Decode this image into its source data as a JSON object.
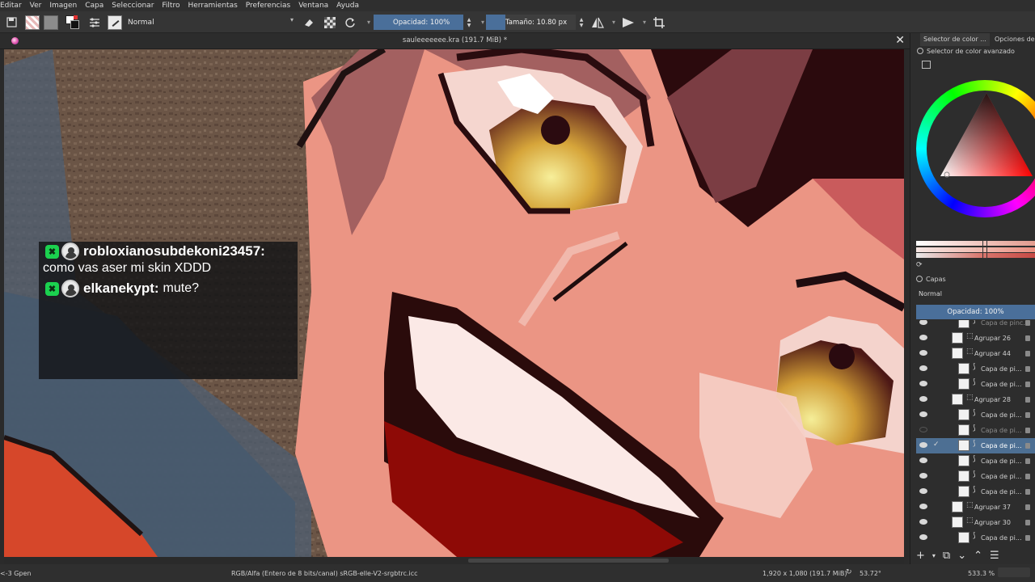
{
  "menu": [
    "Editar",
    "Ver",
    "Imagen",
    "Capa",
    "Seleccionar",
    "Filtro",
    "Herramientas",
    "Preferencias",
    "Ventana",
    "Ayuda"
  ],
  "toolbar": {
    "blend_mode": "Normal",
    "opacity_label": "Opacidad: 100%",
    "opacity_fraction": 1.0,
    "size_label": "Tamaño: 10.80 px"
  },
  "document": {
    "title": "saulееееееe.kra (191.7 MiB) *"
  },
  "chat": {
    "messages": [
      {
        "user": "robloxianosubdekoni23457:",
        "text": "como vas aser mi skin XDDD"
      },
      {
        "user": "elkanekypt:",
        "text": "mute?"
      }
    ]
  },
  "docker": {
    "tabs": [
      "Selector de color ...",
      "Opciones de h"
    ],
    "color_selector_title": "Selector de color avanzado",
    "layers_title": "Capas",
    "layer_blend": "Normal",
    "layer_opacity": "Opacidad:  100%",
    "layers": [
      {
        "name": "Capa de pinc...",
        "group": false,
        "visible": true,
        "dim": true
      },
      {
        "name": "Agrupar 26",
        "group": true,
        "visible": true
      },
      {
        "name": "Agrupar 44",
        "group": true,
        "visible": true
      },
      {
        "name": "Capa de pi...",
        "group": false,
        "visible": true
      },
      {
        "name": "Capa de pi...",
        "group": false,
        "visible": true
      },
      {
        "name": "Agrupar 28",
        "group": true,
        "visible": true
      },
      {
        "name": "Capa de pi...",
        "group": false,
        "visible": true
      },
      {
        "name": "Capa de pi...",
        "group": false,
        "visible": false,
        "dim": true
      },
      {
        "name": "Capa de pi...",
        "group": false,
        "visible": true,
        "selected": true
      },
      {
        "name": "Capa de pi...",
        "group": false,
        "visible": true
      },
      {
        "name": "Capa de pi...",
        "group": false,
        "visible": true
      },
      {
        "name": "Capa de pi...",
        "group": false,
        "visible": true
      },
      {
        "name": "Agrupar 37",
        "group": true,
        "visible": true
      },
      {
        "name": "Agrupar 30",
        "group": true,
        "visible": true
      },
      {
        "name": "Capa de pi...",
        "group": false,
        "visible": true
      }
    ]
  },
  "status": {
    "brush": "<-3 Gpen",
    "color_space": "RGB/Alfa (Entero de 8 bits/canal)  sRGB-elle-V2-srgbtrc.icc",
    "dimensions": "1,920 x 1,080 (191.7 MiB)",
    "rotation": "53.72°",
    "zoom": "533.3 %"
  },
  "colors": {
    "accent": "#4a6f9a",
    "chat_badge": "#1bd14f",
    "skin": "#ec9585",
    "mouth": "#8e0a06"
  }
}
